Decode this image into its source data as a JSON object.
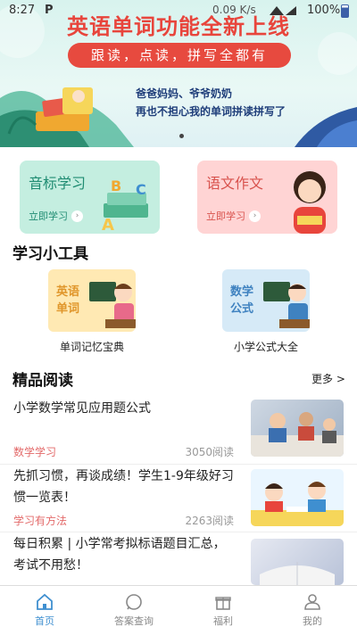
{
  "status": {
    "time": "8:27",
    "p": "P",
    "speed": "0.09 K/s",
    "battery": "100%"
  },
  "banner": {
    "title": "英语单词功能全新上线",
    "pill": "跟读，点读，拼写全都有",
    "line1": "爸爸妈妈、爷爷奶奶",
    "line2": "再也不担心我的单词拼读拼写了"
  },
  "cards": [
    {
      "title": "音标学习",
      "cta": "立即学习"
    },
    {
      "title": "语文作文",
      "cta": "立即学习"
    }
  ],
  "tools_section": {
    "title": "学习小工具"
  },
  "tools": [
    {
      "icon_text_1": "英语",
      "icon_text_2": "单词",
      "label": "单词记忆宝典"
    },
    {
      "icon_text_1": "数学",
      "icon_text_2": "公式",
      "label": "小学公式大全"
    }
  ],
  "reading": {
    "title": "精品阅读",
    "more": "更多 >",
    "articles": [
      {
        "title": "小学数学常见应用题公式",
        "category": "数学学习",
        "reads": "3050阅读"
      },
      {
        "title": "先抓习惯，再谈成绩！学生1-9年级好习惯一览表！",
        "category": "学习有方法",
        "reads": "2263阅读"
      },
      {
        "title": "每日积累 | 小学常考拟标语题目汇总，考试不用愁！",
        "category": "",
        "reads": ""
      }
    ]
  },
  "tabbar": [
    {
      "label": "首页",
      "icon": "home-icon"
    },
    {
      "label": "答案查询",
      "icon": "search-icon"
    },
    {
      "label": "福利",
      "icon": "gift-icon"
    },
    {
      "label": "我的",
      "icon": "user-icon"
    }
  ],
  "colors": {
    "accent": "#3f8fd0",
    "banner_red": "#e74a3f",
    "category": "#e36a6a"
  }
}
